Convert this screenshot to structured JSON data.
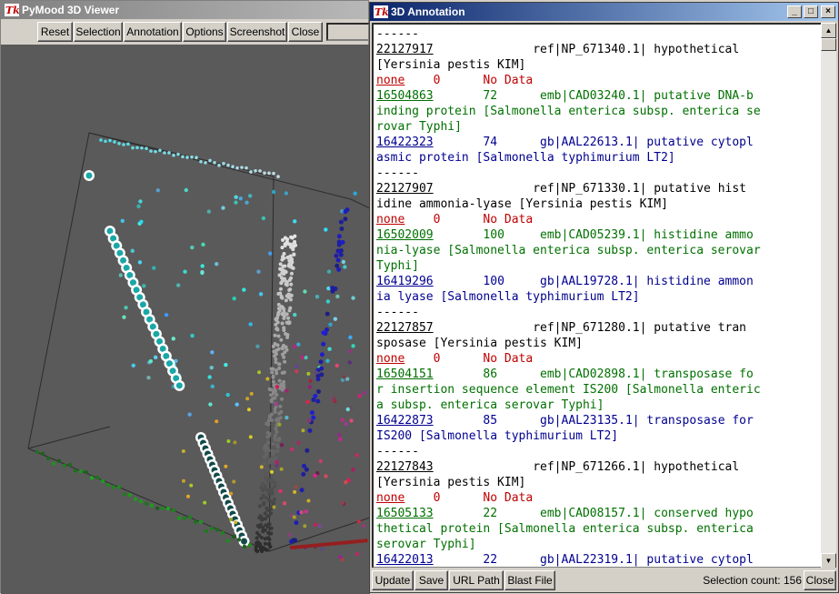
{
  "viewer": {
    "title": "PyMood 3D Viewer",
    "toolbar": {
      "reset": "Reset",
      "selection": "Selection",
      "annotation": "Annotation",
      "options": "Options",
      "screenshot": "Screenshot",
      "close": "Close"
    }
  },
  "annotation": {
    "title": "3D Annotation",
    "lines": [
      {
        "parts": [
          {
            "t": "------",
            "c": "black"
          }
        ]
      },
      {
        "parts": [
          {
            "t": "22127917",
            "c": "black",
            "link": true
          },
          {
            "t": "              ref|NP_671340.1| hypothetical ",
            "c": "black"
          }
        ]
      },
      {
        "parts": [
          {
            "t": "[Yersinia pestis KIM]",
            "c": "black"
          }
        ]
      },
      {
        "parts": [
          {
            "t": "none",
            "c": "red",
            "link": true
          },
          {
            "t": "    0      No Data",
            "c": "red"
          }
        ]
      },
      {
        "parts": [
          {
            "t": "16504863",
            "c": "green",
            "link": true
          },
          {
            "t": "       72      emb|CAD03240.1| putative DNA-b",
            "c": "green"
          }
        ]
      },
      {
        "parts": [
          {
            "t": "inding protein [Salmonella enterica subsp. enterica se",
            "c": "green"
          }
        ]
      },
      {
        "parts": [
          {
            "t": "rovar Typhi]",
            "c": "green"
          }
        ]
      },
      {
        "parts": [
          {
            "t": "16422323",
            "c": "blue",
            "link": true
          },
          {
            "t": "       74      gb|AAL22613.1| putative cytopl",
            "c": "blue"
          }
        ]
      },
      {
        "parts": [
          {
            "t": "asmic protein [Salmonella typhimurium LT2]",
            "c": "blue"
          }
        ]
      },
      {
        "parts": [
          {
            "t": "------",
            "c": "black"
          }
        ]
      },
      {
        "parts": [
          {
            "t": "22127907",
            "c": "black",
            "link": true
          },
          {
            "t": "              ref|NP_671330.1| putative hist",
            "c": "black"
          }
        ]
      },
      {
        "parts": [
          {
            "t": "idine ammonia-lyase [Yersinia pestis KIM]",
            "c": "black"
          }
        ]
      },
      {
        "parts": [
          {
            "t": "none",
            "c": "red",
            "link": true
          },
          {
            "t": "    0      No Data",
            "c": "red"
          }
        ]
      },
      {
        "parts": [
          {
            "t": "16502009",
            "c": "green",
            "link": true
          },
          {
            "t": "       100     emb|CAD05239.1| histidine ammo",
            "c": "green"
          }
        ]
      },
      {
        "parts": [
          {
            "t": "nia-lyase [Salmonella enterica subsp. enterica serovar",
            "c": "green"
          }
        ]
      },
      {
        "parts": [
          {
            "t": "Typhi]",
            "c": "green"
          }
        ]
      },
      {
        "parts": [
          {
            "t": "16419296",
            "c": "blue",
            "link": true
          },
          {
            "t": "       100     gb|AAL19728.1| histidine ammon",
            "c": "blue"
          }
        ]
      },
      {
        "parts": [
          {
            "t": "ia lyase [Salmonella typhimurium LT2]",
            "c": "blue"
          }
        ]
      },
      {
        "parts": [
          {
            "t": "------",
            "c": "black"
          }
        ]
      },
      {
        "parts": [
          {
            "t": "22127857",
            "c": "black",
            "link": true
          },
          {
            "t": "              ref|NP_671280.1| putative tran",
            "c": "black"
          }
        ]
      },
      {
        "parts": [
          {
            "t": "sposase [Yersinia pestis KIM]",
            "c": "black"
          }
        ]
      },
      {
        "parts": [
          {
            "t": "none",
            "c": "red",
            "link": true
          },
          {
            "t": "    0      No Data",
            "c": "red"
          }
        ]
      },
      {
        "parts": [
          {
            "t": "16504151",
            "c": "green",
            "link": true
          },
          {
            "t": "       86      emb|CAD02898.1| transposase fo",
            "c": "green"
          }
        ]
      },
      {
        "parts": [
          {
            "t": "r insertion sequence element IS200 [Salmonella enteric",
            "c": "green"
          }
        ]
      },
      {
        "parts": [
          {
            "t": "a subsp. enterica serovar Typhi]",
            "c": "green"
          }
        ]
      },
      {
        "parts": [
          {
            "t": "16422873",
            "c": "blue",
            "link": true
          },
          {
            "t": "       85      gb|AAL23135.1| transposase for",
            "c": "blue"
          }
        ]
      },
      {
        "parts": [
          {
            "t": "IS200 [Salmonella typhimurium LT2]",
            "c": "blue"
          }
        ]
      },
      {
        "parts": [
          {
            "t": "------",
            "c": "black"
          }
        ]
      },
      {
        "parts": [
          {
            "t": "22127843",
            "c": "black",
            "link": true
          },
          {
            "t": "              ref|NP_671266.1| hypothetical ",
            "c": "black"
          }
        ]
      },
      {
        "parts": [
          {
            "t": "[Yersinia pestis KIM]",
            "c": "black"
          }
        ]
      },
      {
        "parts": [
          {
            "t": "none",
            "c": "red",
            "link": true
          },
          {
            "t": "    0      No Data",
            "c": "red"
          }
        ]
      },
      {
        "parts": [
          {
            "t": "16505133",
            "c": "green",
            "link": true
          },
          {
            "t": "       22      emb|CAD08157.1| conserved hypo",
            "c": "green"
          }
        ]
      },
      {
        "parts": [
          {
            "t": "thetical protein [Salmonella enterica subsp. enterica ",
            "c": "green"
          }
        ]
      },
      {
        "parts": [
          {
            "t": "serovar Typhi]",
            "c": "green"
          }
        ]
      },
      {
        "parts": [
          {
            "t": "16422013",
            "c": "blue",
            "link": true
          },
          {
            "t": "       22      gb|AAL22319.1| putative cytopl",
            "c": "blue"
          }
        ]
      }
    ],
    "buttons": {
      "update": "Update",
      "save": "Save",
      "url_path": "URL Path",
      "blast_file": "Blast File",
      "close": "Close"
    },
    "status": "Selection count: 156"
  }
}
